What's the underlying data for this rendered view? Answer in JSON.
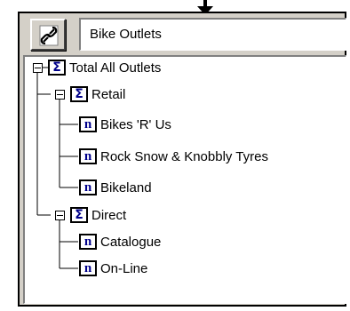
{
  "toolbar": {
    "link_icon": "chain-link-icon",
    "selected_name": "Bike Outlets"
  },
  "tree": {
    "root": {
      "label": "Total All Outlets",
      "icon": "sigma",
      "icon_glyph": "Σ"
    },
    "retail": {
      "label": "Retail",
      "icon": "sigma",
      "icon_glyph": "Σ"
    },
    "retail_children": [
      {
        "label": "Bikes 'R' Us",
        "icon_glyph": "n"
      },
      {
        "label": "Rock Snow & Knobbly Tyres",
        "icon_glyph": "n"
      },
      {
        "label": "Bikeland",
        "icon_glyph": "n"
      }
    ],
    "direct": {
      "label": "Direct",
      "icon": "sigma",
      "icon_glyph": "Σ"
    },
    "direct_children": [
      {
        "label": "Catalogue",
        "icon_glyph": "n"
      },
      {
        "label": "On-Line",
        "icon_glyph": "n"
      }
    ]
  }
}
